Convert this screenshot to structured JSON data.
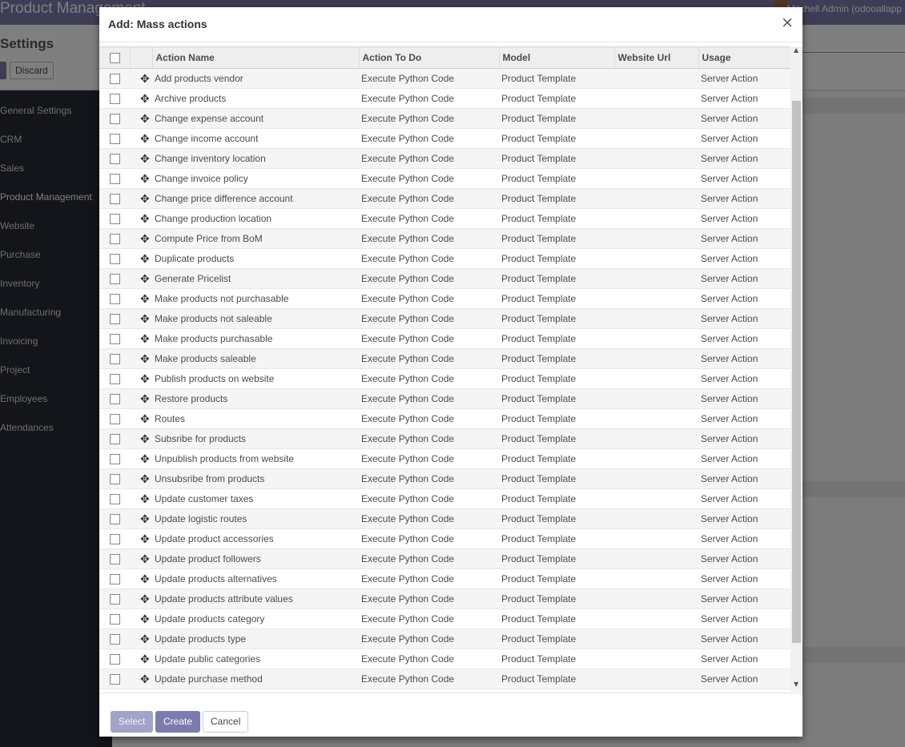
{
  "background": {
    "app_title": "Product Management",
    "user_name": "Mitchell Admin (odooallapp",
    "settings_title": "Settings",
    "discard_label": "Discard",
    "sidebar": [
      "General Settings",
      "CRM",
      "Sales",
      "Product Management",
      "Website",
      "Purchase",
      "Inventory",
      "Manufacturing",
      "Invoicing",
      "Project",
      "Employees",
      "Attendances"
    ]
  },
  "modal": {
    "title": "Add: Mass actions",
    "close_glyph": "×",
    "columns": [
      "Action Name",
      "Action To Do",
      "Model",
      "Website Url",
      "Usage"
    ],
    "rows": [
      {
        "name": "Add products vendor",
        "todo": "Execute Python Code",
        "model": "Product Template",
        "url": "",
        "usage": "Server Action"
      },
      {
        "name": "Archive products",
        "todo": "Execute Python Code",
        "model": "Product Template",
        "url": "",
        "usage": "Server Action"
      },
      {
        "name": "Change expense account",
        "todo": "Execute Python Code",
        "model": "Product Template",
        "url": "",
        "usage": "Server Action"
      },
      {
        "name": "Change income account",
        "todo": "Execute Python Code",
        "model": "Product Template",
        "url": "",
        "usage": "Server Action"
      },
      {
        "name": "Change inventory location",
        "todo": "Execute Python Code",
        "model": "Product Template",
        "url": "",
        "usage": "Server Action"
      },
      {
        "name": "Change invoice policy",
        "todo": "Execute Python Code",
        "model": "Product Template",
        "url": "",
        "usage": "Server Action"
      },
      {
        "name": "Change price difference account",
        "todo": "Execute Python Code",
        "model": "Product Template",
        "url": "",
        "usage": "Server Action"
      },
      {
        "name": "Change production location",
        "todo": "Execute Python Code",
        "model": "Product Template",
        "url": "",
        "usage": "Server Action"
      },
      {
        "name": "Compute Price from BoM",
        "todo": "Execute Python Code",
        "model": "Product Template",
        "url": "",
        "usage": "Server Action"
      },
      {
        "name": "Duplicate products",
        "todo": "Execute Python Code",
        "model": "Product Template",
        "url": "",
        "usage": "Server Action"
      },
      {
        "name": "Generate Pricelist",
        "todo": "Execute Python Code",
        "model": "Product Template",
        "url": "",
        "usage": "Server Action"
      },
      {
        "name": "Make products not purchasable",
        "todo": "Execute Python Code",
        "model": "Product Template",
        "url": "",
        "usage": "Server Action"
      },
      {
        "name": "Make products not saleable",
        "todo": "Execute Python Code",
        "model": "Product Template",
        "url": "",
        "usage": "Server Action"
      },
      {
        "name": "Make products purchasable",
        "todo": "Execute Python Code",
        "model": "Product Template",
        "url": "",
        "usage": "Server Action"
      },
      {
        "name": "Make products saleable",
        "todo": "Execute Python Code",
        "model": "Product Template",
        "url": "",
        "usage": "Server Action"
      },
      {
        "name": "Publish products on website",
        "todo": "Execute Python Code",
        "model": "Product Template",
        "url": "",
        "usage": "Server Action"
      },
      {
        "name": "Restore products",
        "todo": "Execute Python Code",
        "model": "Product Template",
        "url": "",
        "usage": "Server Action"
      },
      {
        "name": "Routes",
        "todo": "Execute Python Code",
        "model": "Product Template",
        "url": "",
        "usage": "Server Action"
      },
      {
        "name": "Subsribe for products",
        "todo": "Execute Python Code",
        "model": "Product Template",
        "url": "",
        "usage": "Server Action"
      },
      {
        "name": "Unpublish products from website",
        "todo": "Execute Python Code",
        "model": "Product Template",
        "url": "",
        "usage": "Server Action"
      },
      {
        "name": "Unsubsribe from products",
        "todo": "Execute Python Code",
        "model": "Product Template",
        "url": "",
        "usage": "Server Action"
      },
      {
        "name": "Update customer taxes",
        "todo": "Execute Python Code",
        "model": "Product Template",
        "url": "",
        "usage": "Server Action"
      },
      {
        "name": "Update logistic routes",
        "todo": "Execute Python Code",
        "model": "Product Template",
        "url": "",
        "usage": "Server Action"
      },
      {
        "name": "Update product accessories",
        "todo": "Execute Python Code",
        "model": "Product Template",
        "url": "",
        "usage": "Server Action"
      },
      {
        "name": "Update product followers",
        "todo": "Execute Python Code",
        "model": "Product Template",
        "url": "",
        "usage": "Server Action"
      },
      {
        "name": "Update products alternatives",
        "todo": "Execute Python Code",
        "model": "Product Template",
        "url": "",
        "usage": "Server Action"
      },
      {
        "name": "Update products attribute values",
        "todo": "Execute Python Code",
        "model": "Product Template",
        "url": "",
        "usage": "Server Action"
      },
      {
        "name": "Update products category",
        "todo": "Execute Python Code",
        "model": "Product Template",
        "url": "",
        "usage": "Server Action"
      },
      {
        "name": "Update products type",
        "todo": "Execute Python Code",
        "model": "Product Template",
        "url": "",
        "usage": "Server Action"
      },
      {
        "name": "Update public categories",
        "todo": "Execute Python Code",
        "model": "Product Template",
        "url": "",
        "usage": "Server Action"
      },
      {
        "name": "Update purchase method",
        "todo": "Execute Python Code",
        "model": "Product Template",
        "url": "",
        "usage": "Server Action"
      }
    ],
    "footer": {
      "select_label": "Select",
      "create_label": "Create",
      "cancel_label": "Cancel"
    }
  },
  "colors": {
    "brand": "#7c7bad",
    "sidebar": "#262a36"
  },
  "icons": {
    "row_handle": "drag-handle-icon",
    "close": "close-icon"
  }
}
